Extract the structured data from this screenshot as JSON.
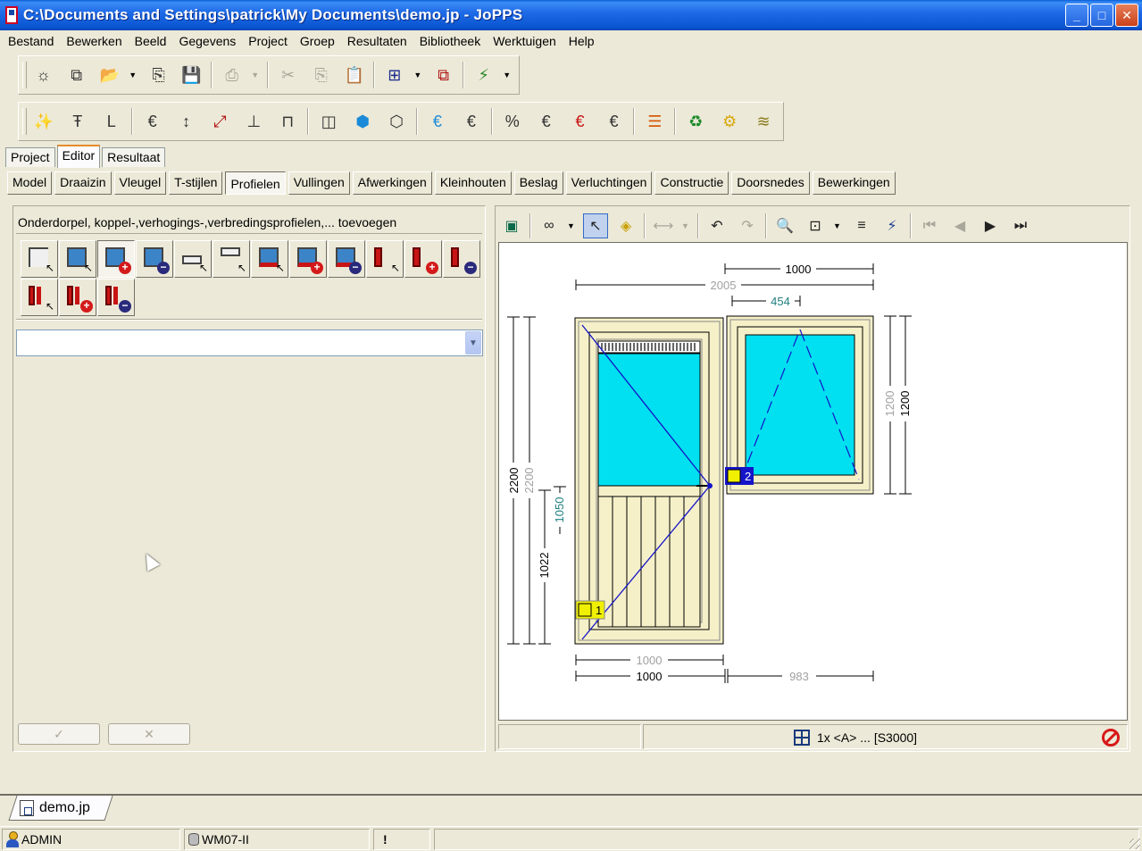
{
  "window": {
    "title": "C:\\Documents and Settings\\patrick\\My Documents\\demo.jp - JoPPS",
    "controls": [
      "minimize-icon",
      "maximize-icon",
      "close-icon"
    ]
  },
  "menu": [
    "Bestand",
    "Bewerken",
    "Beeld",
    "Gegevens",
    "Project",
    "Groep",
    "Resultaten",
    "Bibliotheek",
    "Werktuigen",
    "Help"
  ],
  "main_tabs": [
    "Project",
    "Editor",
    "Resultaat"
  ],
  "main_tab_active": "Editor",
  "sub_tabs": [
    "Model",
    "Draaizin",
    "Vleugel",
    "T-stijlen",
    "Profielen",
    "Vullingen",
    "Afwerkingen",
    "Kleinhouten",
    "Beslag",
    "Verluchtingen",
    "Constructie",
    "Doorsnedes",
    "Bewerkingen"
  ],
  "sub_tab_active": "Profielen",
  "left_panel": {
    "header": "Onderdorpel, koppel-,verhogings-,verbredingsprofielen,... toevoegen",
    "combo_value": "",
    "ok_glyph": "✓",
    "cancel_glyph": "✕"
  },
  "drawing": {
    "dims": {
      "top_1000": "1000",
      "top_2005": "2005",
      "top_454": "454",
      "left_2200_a": "2200",
      "left_2200_b": "2200",
      "left_1022": "1022",
      "left_1050": "1050",
      "right_1200_a": "1200",
      "right_1200_b": "1200",
      "bottom_1000_a": "1000",
      "bottom_1000_b": "1000",
      "bottom_983": "983"
    },
    "markers": {
      "m1": "1",
      "m2": "2"
    },
    "colors": {
      "frame": "#f5f0c8",
      "glass": "#00e0f0",
      "panel": "#f5f0c8",
      "dim_black": "#000000",
      "dim_gray": "#a0a0a0",
      "dim_teal": "#208080",
      "swing_line": "#1414c8"
    }
  },
  "drawing_status": {
    "text": "1x <A> ... [S3000]"
  },
  "doc_tab": "demo.jp",
  "statusbar": {
    "user": "ADMIN",
    "db": "WM07-II",
    "alert": "!"
  }
}
